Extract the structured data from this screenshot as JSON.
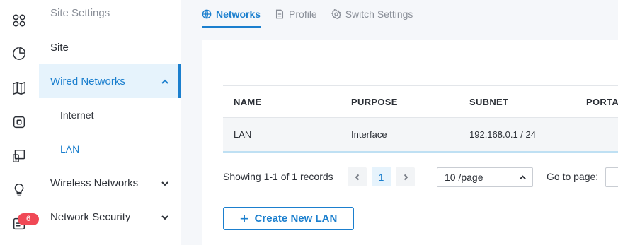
{
  "rail": {
    "icons": [
      "apps-icon",
      "pie-chart-icon",
      "map-icon",
      "device-icon",
      "devices-icon",
      "lightbulb-icon",
      "log-icon"
    ],
    "notification_badge": "6"
  },
  "sidebar": {
    "header": "Site Settings",
    "items": [
      {
        "label": "Site"
      },
      {
        "label": "Wired Networks"
      },
      {
        "label": "Internet"
      },
      {
        "label": "LAN"
      },
      {
        "label": "Wireless Networks"
      },
      {
        "label": "Network Security"
      }
    ]
  },
  "tabs": [
    {
      "label": "Networks",
      "icon": "globe-icon"
    },
    {
      "label": "Profile",
      "icon": "document-icon"
    },
    {
      "label": "Switch Settings",
      "icon": "gear-icon"
    }
  ],
  "table": {
    "columns": [
      "NAME",
      "PURPOSE",
      "SUBNET",
      "PORTA"
    ],
    "rows": [
      {
        "name": "LAN",
        "purpose": "Interface",
        "subnet": "192.168.0.1 / 24"
      }
    ]
  },
  "pagination": {
    "records_text": "Showing 1-1 of 1 records",
    "current_page": "1",
    "page_size": "10 /page",
    "goto_label": "Go to page:"
  },
  "create_button_label": "Create New LAN",
  "colors": {
    "accent": "#1b7fce",
    "badge": "#f04956",
    "active_bg": "#e6f3fc"
  }
}
